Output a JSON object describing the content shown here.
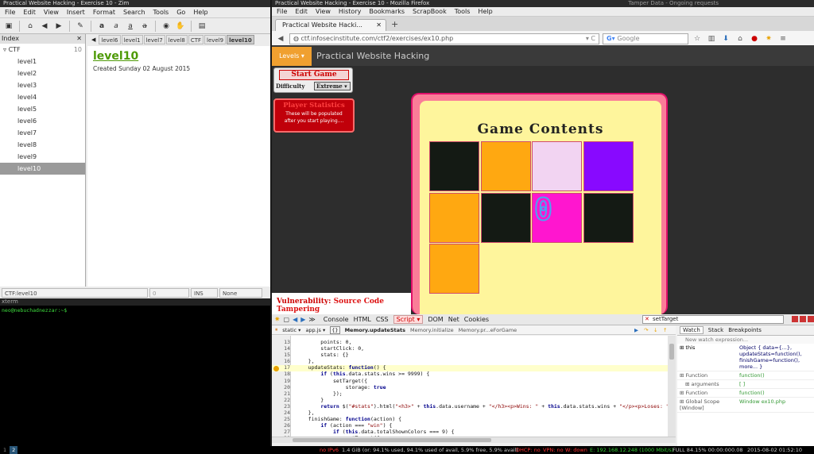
{
  "zim": {
    "title": "Practical Website Hacking - Exercise 10 - Zim",
    "menu": [
      "File",
      "Edit",
      "View",
      "Insert",
      "Format",
      "Search",
      "Tools",
      "Go",
      "Help"
    ],
    "index_header": "Index",
    "root": {
      "label": "CTF",
      "count": "10"
    },
    "pages": [
      "level1",
      "level2",
      "level3",
      "level4",
      "level5",
      "level6",
      "level7",
      "level8",
      "level9",
      "level10"
    ],
    "tabs": [
      "level6",
      "level1",
      "level7",
      "level8",
      "CTF",
      "level9",
      "level10"
    ],
    "page_title": "level10",
    "created": "Created Sunday 02 August 2015",
    "status": {
      "path": "CTF:level10",
      "backlinks": "0 Backlinks...",
      "mode": "INS",
      "style": "None"
    }
  },
  "terminal": {
    "title": "xterm",
    "prompt": "neo@nebuchadnezzar:~$ "
  },
  "firefox": {
    "title": "Practical Website Hacking - Exercise 10 - Mozilla Firefox",
    "tamper_title": "Tamper Data - Ongoing requests",
    "menu": [
      "File",
      "Edit",
      "View",
      "History",
      "Bookmarks",
      "ScrapBook",
      "Tools",
      "Help"
    ],
    "tab_label": "Practical Website Hacki...",
    "url": "ctf.infosecinstitute.com/ctf2/exercises/ex10.php",
    "search_placeholder": "Google"
  },
  "page": {
    "levels_button": "Levels",
    "site_title": "Practical Website Hacking",
    "start_game": "Start Game",
    "difficulty_label": "Difficulty",
    "difficulty_value": "Extreme",
    "stats_title": "Player Statistics",
    "stats_text": "These will be populated after you start playing....",
    "game_title": "Game Contents",
    "tile_zero": "0",
    "vulnerability_label": "Vulnerability:",
    "vulnerability_value": "Source Code Tampering",
    "tiles": [
      "#141a14",
      "#ffa811",
      "#f2d4f2",
      "#8809ff",
      "#ffa811",
      "#141a14",
      "#ff16cf",
      "#141a14",
      "#ffa811"
    ]
  },
  "firebug": {
    "tabs": [
      "Console",
      "HTML",
      "CSS",
      "Script",
      "DOM",
      "Net",
      "Cookies"
    ],
    "search_value": "setTarget",
    "script_filter": "static",
    "script_file": "app.js",
    "breadcrumb": [
      "Memory.updateStats",
      "Memory.initialize",
      "Memory.pr...eForGame"
    ],
    "line_numbers": [
      "13",
      "14",
      "15",
      "16",
      "17",
      "18",
      "19",
      "20",
      "21",
      "22",
      "23",
      "24",
      "25",
      "26",
      "27",
      "28",
      "29"
    ],
    "code_lines": [
      "        points: 0,",
      "        startClick: 0,",
      "        stats: {}",
      "    },",
      "    updateStats: function() {",
      "        if (this.data.stats.wins >= 9999) {",
      "            setTarget({",
      "                storage: true",
      "            });",
      "        }",
      "        return $(\"#stats\").html(\"<h3>\" + this.data.username + \"</h3><p>Wins: \" + this.data.stats.wins + \"</p><p>Loses: \" + th",
      "    },",
      "    finishGame: function(action) {",
      "        if (action === \"win\") {",
      "            if (this.data.totalShownColors === 9) {",
      "                setTarget({",
      "                    extreme: true"
    ],
    "watch_tabs": [
      "Watch",
      "Stack",
      "Breakpoints"
    ],
    "new_watch": "New watch expression...",
    "watch_rows": [
      {
        "name": "this",
        "value": "Object { data={...}, updateStats=function(), finishGame=function(), more... }"
      },
      {
        "name": "Function",
        "value": "function()"
      },
      {
        "name": "arguments",
        "value": "[ ]"
      },
      {
        "name": "Function",
        "value": "function()"
      },
      {
        "name": "Global Scope [Window]",
        "value": "Window ex10.php"
      }
    ]
  },
  "sysbar": {
    "workspaces": [
      "1",
      "2"
    ],
    "left_items": [
      "no IPv6",
      "1.4 GiB (or: 94.1% used, 94.1% used of avail, 5.9% free, 5.9% avail)"
    ],
    "dhcp": "DHCP: no",
    "vpn": "VPN: no",
    "wifi": "W: down",
    "eth": "E: 192.168.12.248 (1000 Mbit/s)",
    "battery": "FULL 84.15% 00:00:00",
    "load": "0.08",
    "datetime": "2015-08-02 01:52:10"
  }
}
